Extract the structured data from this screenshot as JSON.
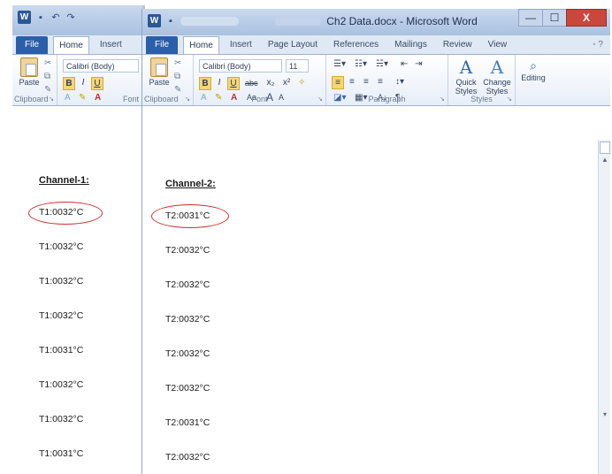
{
  "win1": {
    "app_icon": "W",
    "tabs": {
      "file": "File",
      "home": "Home",
      "insert": "Insert"
    },
    "clipboard": {
      "paste_label": "Paste",
      "group_label": "Clipboard"
    },
    "font": {
      "name": "Calibri (Body)",
      "bold": "B",
      "italic": "I",
      "underline": "U",
      "group_label": "Font"
    },
    "doc": {
      "header": "Channel-1:",
      "readings": [
        "T1:0032°C",
        "T1:0032°C",
        "T1:0032°C",
        "T1:0032°C",
        "T1:0031°C",
        "T1:0032°C",
        "T1:0032°C",
        "T1:0031°C"
      ]
    }
  },
  "win2": {
    "app_icon": "W",
    "title": "Ch2 Data.docx - Microsoft Word",
    "controls": {
      "minimize": "—",
      "maximize": "☐",
      "close": "X"
    },
    "tabs": {
      "file": "File",
      "home": "Home",
      "insert": "Insert",
      "page_layout": "Page Layout",
      "references": "References",
      "mailings": "Mailings",
      "review": "Review",
      "view": "View"
    },
    "clipboard": {
      "paste_label": "Paste",
      "group_label": "Clipboard"
    },
    "font": {
      "name": "Calibri (Body)",
      "size": "11",
      "bold": "B",
      "italic": "I",
      "underline": "U",
      "strike": "abc",
      "sub": "x₂",
      "sup": "x²",
      "grow": "A",
      "shrink": "A",
      "change_case": "Aa",
      "group_label": "Font"
    },
    "paragraph": {
      "group_label": "Paragraph",
      "sort": "A↓",
      "pilcrow": "¶"
    },
    "styles": {
      "quick": "Quick Styles",
      "change": "Change Styles",
      "group_label": "Styles"
    },
    "editing": {
      "label": "Editing"
    },
    "doc": {
      "header": "Channel-2:",
      "readings": [
        "T2:0031°C",
        "T2:0032°C",
        "T2:0032°C",
        "T2:0032°C",
        "T2:0032°C",
        "T2:0032°C",
        "T2:0031°C",
        "T2:0032°C"
      ]
    }
  },
  "colors": {
    "annotation_circle": "#c8302b",
    "file_tab": "#2a5ea8",
    "close_button": "#c9473d",
    "highlight": "#f6d676"
  }
}
